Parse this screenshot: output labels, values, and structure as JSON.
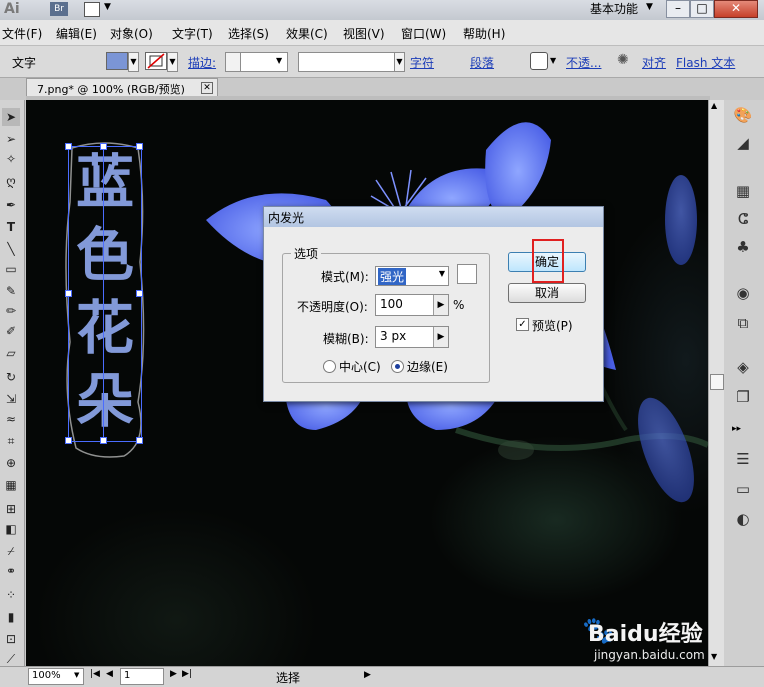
{
  "app": {
    "logo": "Ai",
    "br_badge": "Br",
    "workspace": "基本功能"
  },
  "menu": [
    "文件(F)",
    "编辑(E)",
    "对象(O)",
    "文字(T)",
    "选择(S)",
    "效果(C)",
    "视图(V)",
    "窗口(W)",
    "帮助(H)"
  ],
  "control": {
    "tool_label": "文字",
    "fill_color": "#7b95d6",
    "stroke_label": "描边:",
    "char_link": "字符",
    "para_link": "段落",
    "opacity_link": "不透...",
    "align_link": "对齐",
    "flash_link": "Flash 文本"
  },
  "document": {
    "tab_title": "7.png* @ 100% (RGB/预览)"
  },
  "canvas": {
    "text_chars": [
      "蓝",
      "色",
      "花",
      "朵"
    ],
    "text_color": "#8299d8",
    "flower_color": "#6f87ff"
  },
  "dialog": {
    "title": "内发光",
    "group_label": "选项",
    "mode_label": "模式(M):",
    "mode_value": "强光",
    "opacity_label": "不透明度(O):",
    "opacity_value": "100",
    "opacity_unit": "%",
    "blur_label": "模糊(B):",
    "blur_value": "3 px",
    "radio_center": "中心(C)",
    "radio_edge": "边缘(E)",
    "ok_label": "确定",
    "cancel_label": "取消",
    "preview_label": "预览(P)"
  },
  "status": {
    "zoom": "100%",
    "page": "1",
    "tool": "选择"
  },
  "watermark": {
    "brand": "Baidu经验",
    "url": "jingyan.baidu.com"
  }
}
